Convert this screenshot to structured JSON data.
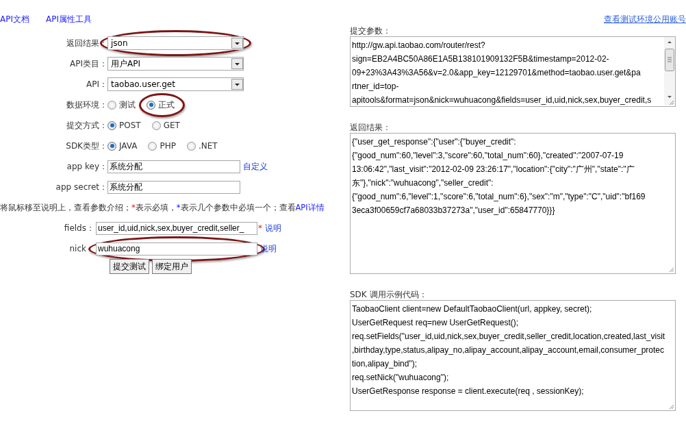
{
  "top_links": [
    {
      "label": "API文档"
    },
    {
      "label": "API属性工具"
    }
  ],
  "account_link": "查看测试环境公用账号",
  "form": [
    {
      "kind": "select",
      "label": "返回结果：",
      "value": "json",
      "highlighted": true
    },
    {
      "kind": "select",
      "label": "API类目：",
      "value": "用户API",
      "highlighted": false
    },
    {
      "kind": "select",
      "label": "API：",
      "value": "taobao.user.get",
      "highlighted": false
    },
    {
      "kind": "radio",
      "label": "数据环境：",
      "options": [
        {
          "label": "测试",
          "selected": false,
          "highlighted": false
        },
        {
          "label": "正式",
          "selected": true,
          "highlighted": true
        }
      ]
    },
    {
      "kind": "radio",
      "label": "提交方式：",
      "options": [
        {
          "label": "POST",
          "selected": true,
          "highlighted": false
        },
        {
          "label": "GET",
          "selected": false,
          "highlighted": false
        }
      ]
    },
    {
      "kind": "radio",
      "label": "SDK类型：",
      "options": [
        {
          "label": "JAVA",
          "selected": true,
          "highlighted": false
        },
        {
          "label": "PHP",
          "selected": false,
          "highlighted": false
        },
        {
          "label": ".NET",
          "selected": false,
          "highlighted": false
        }
      ]
    },
    {
      "kind": "input",
      "label": "app key：",
      "value": "系统分配",
      "link": "自定义",
      "highlighted": false
    },
    {
      "kind": "input",
      "label": "app secret：",
      "value": "系统分配",
      "highlighted": false
    }
  ],
  "hint": {
    "text_1": "将鼠标移至说明上，查看参数介绍；",
    "required_mark": "*",
    "text_2": " 表示必填，",
    "optional_mark": "*",
    "text_3": " 表示几个参数中必填一个；查看",
    "link": "API详情"
  },
  "params": [
    {
      "label": "fields：",
      "value": "user_id,uid,nick,sex,buyer_credit,seller_",
      "required_mark": "*",
      "link": "说明",
      "highlighted": false
    },
    {
      "label": "nick：",
      "value": "wuhuacong",
      "link": "说明",
      "highlighted": true
    }
  ],
  "buttons": [
    "提交测试",
    "绑定用户"
  ],
  "panels": [
    {
      "kind": "scroll",
      "label": "提交参数：",
      "lines": [
        "http://gw.api.taobao.com/router/rest?",
        "sign=EB2A4BC50A86E1A5B138101909132F5B&timestamp=2012-02-",
        "09+23%3A43%3A56&v=2.0&app_key=12129701&method=taobao.user.get&pa",
        "rtner_id=top-",
        "apitools&format=json&nick=wuhuacong&fields=user_id,uid,nick,sex,buyer_credit,s"
      ]
    },
    {
      "kind": "plain",
      "label": "返回结果：",
      "lines": [
        "{\"user_get_response\":{\"user\":{\"buyer_credit\":",
        "{\"good_num\":60,\"level\":3,\"score\":60,\"total_num\":60},\"created\":\"2007-07-19",
        "13:06:42\",\"last_visit\":\"2012-02-09 23:26:17\",\"location\":{\"city\":\"广州\",\"state\":\"广",
        "东\"},\"nick\":\"wuhuacong\",\"seller_credit\":",
        "{\"good_num\":6,\"level\":1,\"score\":6,\"total_num\":6},\"sex\":\"m\",\"type\":\"C\",\"uid\":\"bf169",
        "3eca3f00659cf7a68033b37273a\",\"user_id\":65847770}}}"
      ]
    },
    {
      "kind": "plain",
      "label": "SDK 调用示例代码：",
      "lines": [
        "TaobaoClient client=new DefaultTaobaoClient(url, appkey, secret);",
        "UserGetRequest req=new UserGetRequest();",
        "req.setFields(\"user_id,uid,nick,sex,buyer_credit,seller_credit,location,created,last_visit",
        ",birthday,type,status,alipay_no,alipay_account,alipay_account,email,consumer_protec",
        "tion,alipay_bind\");",
        "req.setNick(\"wuhuacong\");",
        "UserGetResponse response = client.execute(req , sessionKey);"
      ]
    }
  ]
}
